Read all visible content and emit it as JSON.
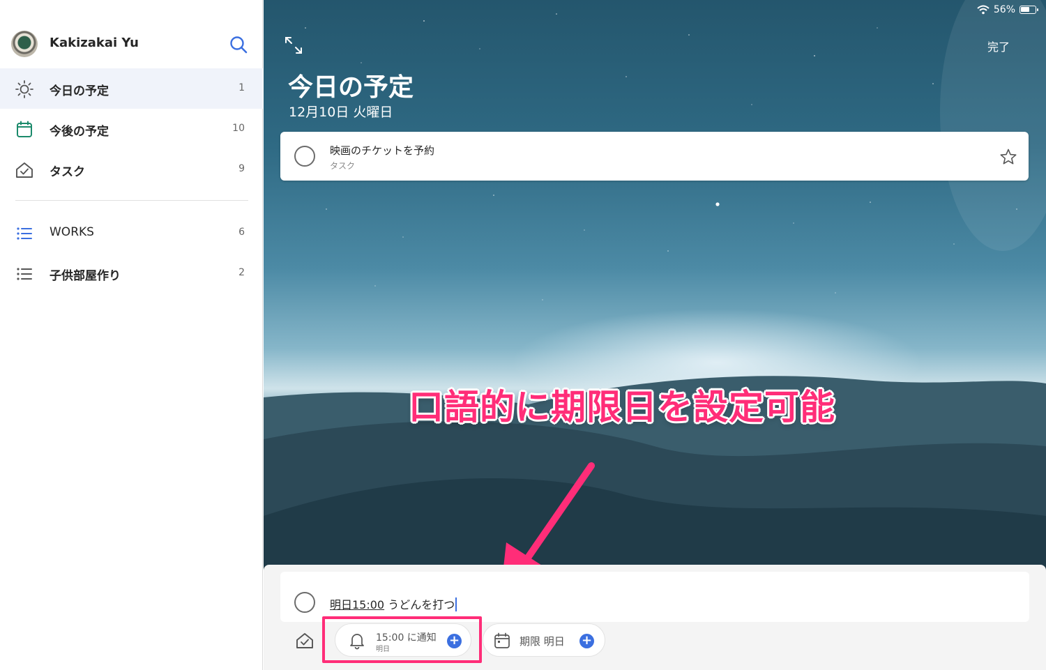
{
  "sidebar": {
    "profile_name": "Kakizakai Yu",
    "items": [
      {
        "label": "今日の予定",
        "count": "1",
        "icon": "sun-icon"
      },
      {
        "label": "今後の予定",
        "count": "10",
        "icon": "calendar-icon"
      },
      {
        "label": "タスク",
        "count": "9",
        "icon": "home-check-icon"
      },
      {
        "label": "WORKS",
        "count": "6",
        "icon": "list-icon"
      },
      {
        "label": "子供部屋作り",
        "count": "2",
        "icon": "list-icon"
      }
    ]
  },
  "status_bar": {
    "battery": "56%"
  },
  "main": {
    "title": "今日の予定",
    "date": "12月10日 火曜日",
    "done_label": "完了",
    "tasks": [
      {
        "title": "映画のチケットを予約",
        "list": "タスク"
      }
    ]
  },
  "annotation": {
    "text": "口語的に期限日を設定可能"
  },
  "input": {
    "parsed": "明日15:00",
    "text": " うどんを打つ",
    "reminder_main": "15:00 に通知",
    "reminder_sub": "明日",
    "due_label": "期限 明日"
  },
  "colors": {
    "accent": "#3b6fe0",
    "annotation": "#ff2d78",
    "active_row": "#f0f3fa"
  }
}
